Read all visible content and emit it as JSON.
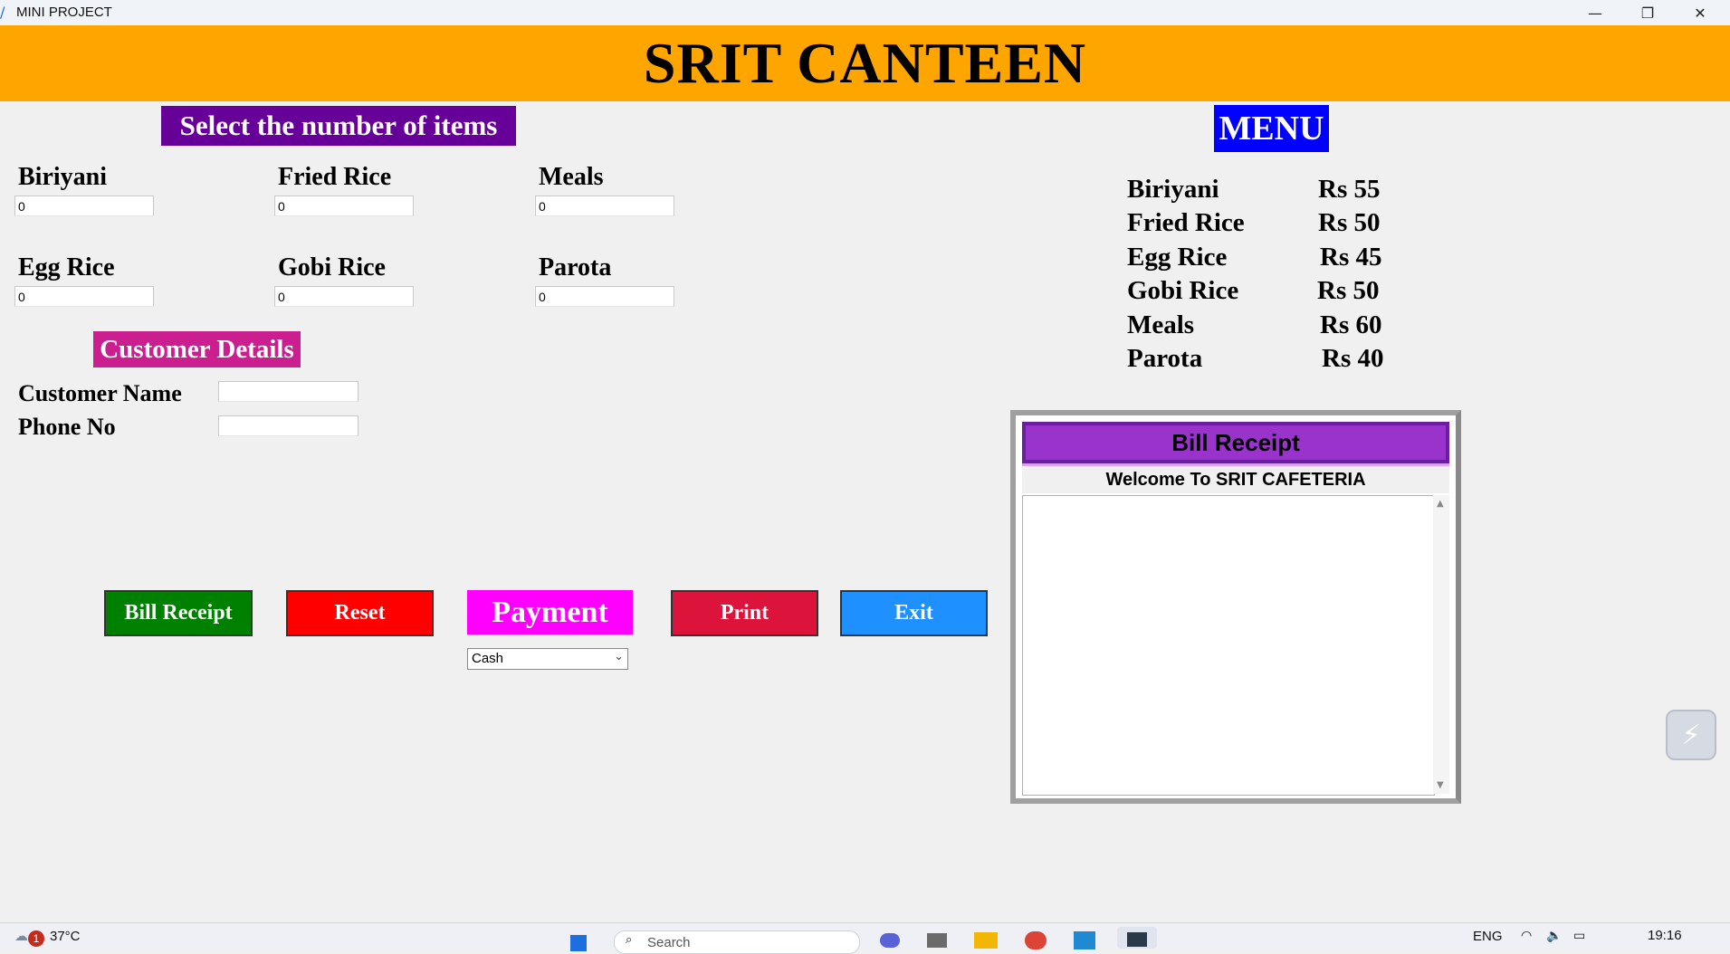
{
  "window": {
    "title": "MINI PROJECT",
    "minimize": "—",
    "restore": "❐",
    "close": "✕"
  },
  "header": {
    "title": "SRIT CANTEEN"
  },
  "order": {
    "heading": "Select the number of items",
    "items": [
      {
        "label": "Biriyani",
        "value": "0"
      },
      {
        "label": "Fried Rice",
        "value": "0"
      },
      {
        "label": "Meals",
        "value": "0"
      },
      {
        "label": "Egg Rice",
        "value": "0"
      },
      {
        "label": "Gobi Rice",
        "value": "0"
      },
      {
        "label": "Parota",
        "value": "0"
      }
    ]
  },
  "customer": {
    "heading": "Customer Details",
    "name_label": "Customer Name",
    "name_value": "",
    "phone_label": "Phone No",
    "phone_value": ""
  },
  "menu": {
    "heading": "MENU",
    "items": [
      {
        "name": "Biriyani",
        "price": "Rs 55"
      },
      {
        "name": "Fried Rice",
        "price": "Rs 50"
      },
      {
        "name": "Egg Rice",
        "price": "Rs 45"
      },
      {
        "name": "Gobi Rice",
        "price": "Rs 50"
      },
      {
        "name": "Meals",
        "price": "Rs 60"
      },
      {
        "name": "Parota",
        "price": "Rs 40"
      }
    ]
  },
  "buttons": {
    "bill_receipt": "Bill Receipt",
    "reset": "Reset",
    "payment": "Payment",
    "print": "Print",
    "exit": "Exit"
  },
  "payment": {
    "selected": "Cash"
  },
  "receipt": {
    "title": "Bill Receipt",
    "welcome": "Welcome To SRIT CAFETERIA",
    "content": ""
  },
  "taskbar": {
    "weather": "37°C",
    "weather_badge": "1",
    "search": "Search",
    "language": "ENG",
    "time": "19:16"
  },
  "colors": {
    "banner": "#ffa500",
    "items_heading": "#660099",
    "customer_heading": "#cc1f8f",
    "menu_heading": "#0000ff",
    "bill_button": "#008000",
    "reset_button": "#ff0000",
    "payment_label": "#ff00ff",
    "print_button": "#dc143c",
    "exit_button": "#1e90ff",
    "receipt_title": "#9933cc"
  }
}
